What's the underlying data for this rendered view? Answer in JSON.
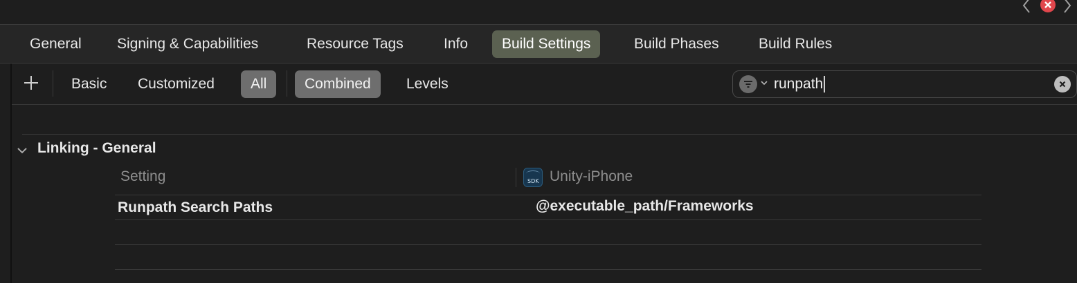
{
  "tabs": [
    {
      "label": "General"
    },
    {
      "label": "Signing & Capabilities"
    },
    {
      "label": "Resource Tags"
    },
    {
      "label": "Info"
    },
    {
      "label": "Build Settings",
      "active": true
    },
    {
      "label": "Build Phases"
    },
    {
      "label": "Build Rules"
    }
  ],
  "toolbar": {
    "add_icon": "plus-icon",
    "basic": "Basic",
    "customized": "Customized",
    "all": "All",
    "combined": "Combined",
    "levels": "Levels"
  },
  "search": {
    "value": "runpath",
    "filter_icon": "filter-icon",
    "clear_icon": "clear-icon"
  },
  "group": {
    "title": "Linking - General",
    "columns": {
      "setting": "Setting",
      "target": "Unity-iPhone"
    },
    "rows": [
      {
        "label": "Runpath Search Paths",
        "value": "@executable_path/Frameworks"
      }
    ]
  },
  "colors": {
    "background": "#1e1e1e",
    "active_tab": "#5b6151",
    "active_segment": "#6e6e6e",
    "close_badge": "#e0464c"
  }
}
